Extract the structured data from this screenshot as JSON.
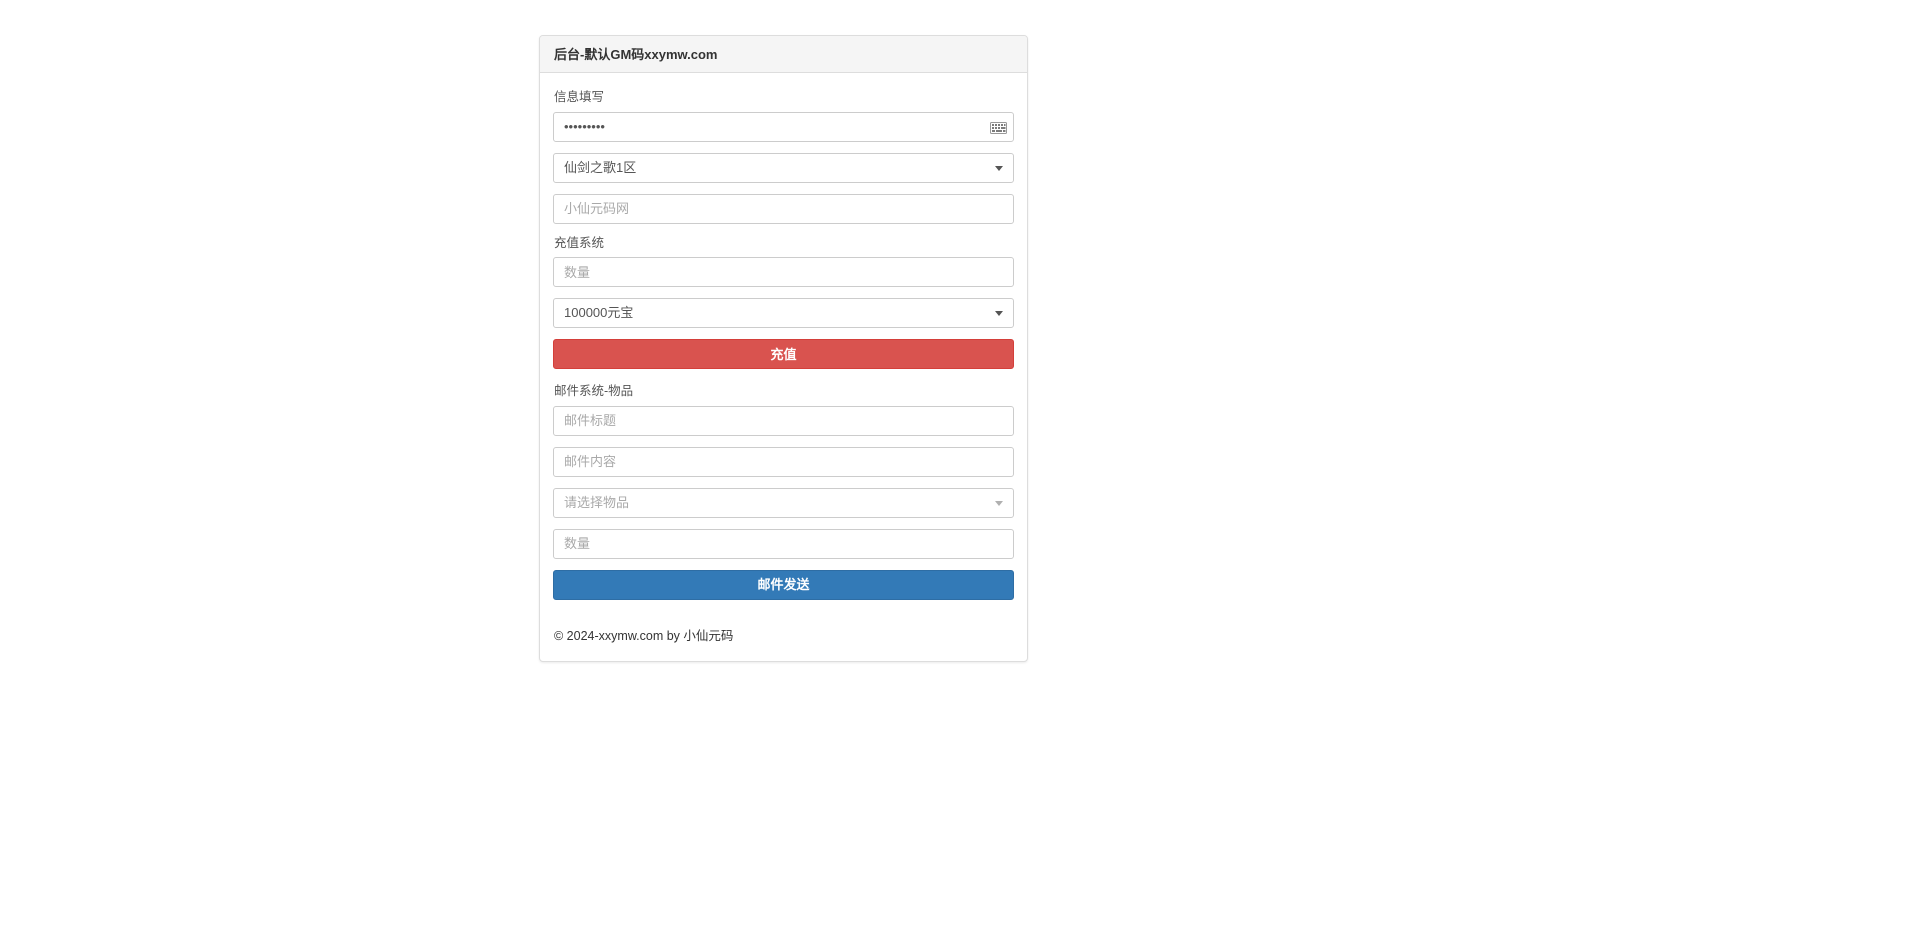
{
  "panel": {
    "title": "后台-默认GM码xxymw.com"
  },
  "info_section": {
    "label": "信息填写",
    "password": {
      "value": "•••••••••",
      "placeholder": "",
      "icon": "keyboard-icon"
    },
    "server_select": {
      "selected": "仙剑之歌1区",
      "options": [
        "仙剑之歌1区"
      ],
      "icon": "chevron-down-icon"
    },
    "account": {
      "value": "",
      "placeholder": "小仙元码网"
    }
  },
  "recharge_section": {
    "label": "充值系统",
    "amount": {
      "value": "",
      "placeholder": "数量"
    },
    "currency_select": {
      "selected": "100000元宝",
      "options": [
        "100000元宝"
      ],
      "icon": "chevron-down-icon"
    },
    "submit_label": "充值",
    "submit_color": "#d9534f"
  },
  "mail_section": {
    "label": "邮件系统-物品",
    "title_field": {
      "value": "",
      "placeholder": "邮件标题"
    },
    "content_field": {
      "value": "",
      "placeholder": "邮件内容"
    },
    "item_select": {
      "selected": "请选择物品",
      "options": [
        "请选择物品"
      ],
      "icon": "chevron-down-icon"
    },
    "quantity_field": {
      "value": "",
      "placeholder": "数量"
    },
    "submit_label": "邮件发送",
    "submit_color": "#337ab7"
  },
  "footer": {
    "text": "© 2024-xxymw.com by 小仙元码"
  }
}
